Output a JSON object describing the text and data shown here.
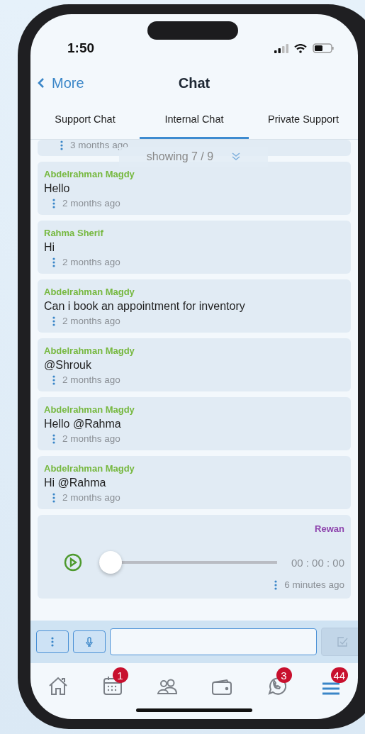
{
  "status_bar": {
    "time": "1:50"
  },
  "header": {
    "back": "More",
    "title": "Chat"
  },
  "tabs": [
    {
      "label": "Support Chat",
      "selected": false
    },
    {
      "label": "Internal Chat",
      "selected": true
    },
    {
      "label": "Private Support",
      "selected": false
    }
  ],
  "paging": {
    "label": "showing 7 / 9"
  },
  "messages": [
    {
      "kind": "cut",
      "time": "3 months ago"
    },
    {
      "kind": "text",
      "author": "Abdelrahman Magdy",
      "color": "#76b83f",
      "text": "Hello",
      "time": "2 months ago"
    },
    {
      "kind": "text",
      "author": "Rahma Sherif",
      "color": "#76b83f",
      "text": "Hi",
      "time": "2 months ago"
    },
    {
      "kind": "text",
      "author": "Abdelrahman Magdy",
      "color": "#76b83f",
      "text": "Can i book an appointment for inventory",
      "time": "2 months ago"
    },
    {
      "kind": "text",
      "author": "Abdelrahman Magdy",
      "color": "#76b83f",
      "text": "@Shrouk",
      "time": "2 months ago"
    },
    {
      "kind": "text",
      "author": "Abdelrahman Magdy",
      "color": "#76b83f",
      "text": "Hello @Rahma",
      "time": "2 months ago"
    },
    {
      "kind": "text",
      "author": "Abdelrahman Magdy",
      "color": "#76b83f",
      "text": "Hi @Rahma",
      "time": "2 months ago"
    },
    {
      "kind": "voice",
      "author": "Rewan",
      "color": "#8e44ad",
      "level": 0,
      "duration": "00 : 00 : 00",
      "time": "6 minutes ago"
    }
  ],
  "composer": {
    "send_disabled": true
  },
  "nav": [
    {
      "kind": "home",
      "selected": false
    },
    {
      "kind": "calendar",
      "badge": "1",
      "selected": false
    },
    {
      "kind": "people",
      "selected": false
    },
    {
      "kind": "wallet",
      "selected": false
    },
    {
      "kind": "phone",
      "badge": "3",
      "selected": false
    },
    {
      "kind": "menu",
      "badge": "44",
      "selected": true
    }
  ]
}
